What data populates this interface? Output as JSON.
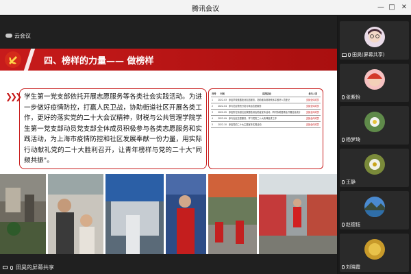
{
  "window": {
    "title": "腾讯会议",
    "controls": {
      "minimize": "—",
      "maximize": "□",
      "close": "✕"
    }
  },
  "share_label": "云会议",
  "slide": {
    "section_title": "四、榜样的力量—— 做榜样",
    "body_text": "学生第一党支部依托开展志愿服务等各类社会实践活动。为进一步做好疫情防控，打赢人民卫战，协助街道社区开展各类工作，更好的落实党的二十大会议精神，财税与公共管理学院学生第一党支部动员党支部全体成员积极参与各类志愿服务和实践活动，为上海市疫情防控和社区发展奉献一份力量，用实际行动献礼党的二十大胜利召开，让青年榜样与党的二十大\"同频共振\"。",
    "table": {
      "headers": [
        "序号",
        "时间",
        "实践活动",
        "参与人员"
      ],
      "rows": [
        [
          "1",
          "2022.03",
          "参加学校核酸检测志愿服务，协助维持现场秩序并做好人员登记",
          "支部全体成员"
        ],
        [
          "2",
          "2022.04",
          "参与社区物资分发与转运志愿服务",
          "支部全体成员"
        ],
        [
          "3",
          "2022.05",
          "参加所在街道社区核酸检测及防疫宣传活动，同时协助居委会开展信息统计",
          "支部全体成员"
        ],
        [
          "4",
          "2022.09",
          "参与社区志愿服务，学习党的二十大精神宣讲工作",
          "支部全体成员"
        ],
        [
          "5",
          "2022.10",
          "参加党的二十大主题宣传实践活动",
          "支部全体成员"
        ]
      ]
    }
  },
  "presenter_label": "田昊的屏幕共享",
  "participants": [
    {
      "name": "田昊(屏幕共享)"
    },
    {
      "name": "张紫怡"
    },
    {
      "name": "杨梦琦"
    },
    {
      "name": "王静"
    },
    {
      "name": "赵德钰"
    },
    {
      "name": "刘晓霞"
    }
  ],
  "colors": {
    "accent": "#c71b1b",
    "tile_bg": "#2a2a2a",
    "titlebar_bg": "#f3f3f3"
  }
}
